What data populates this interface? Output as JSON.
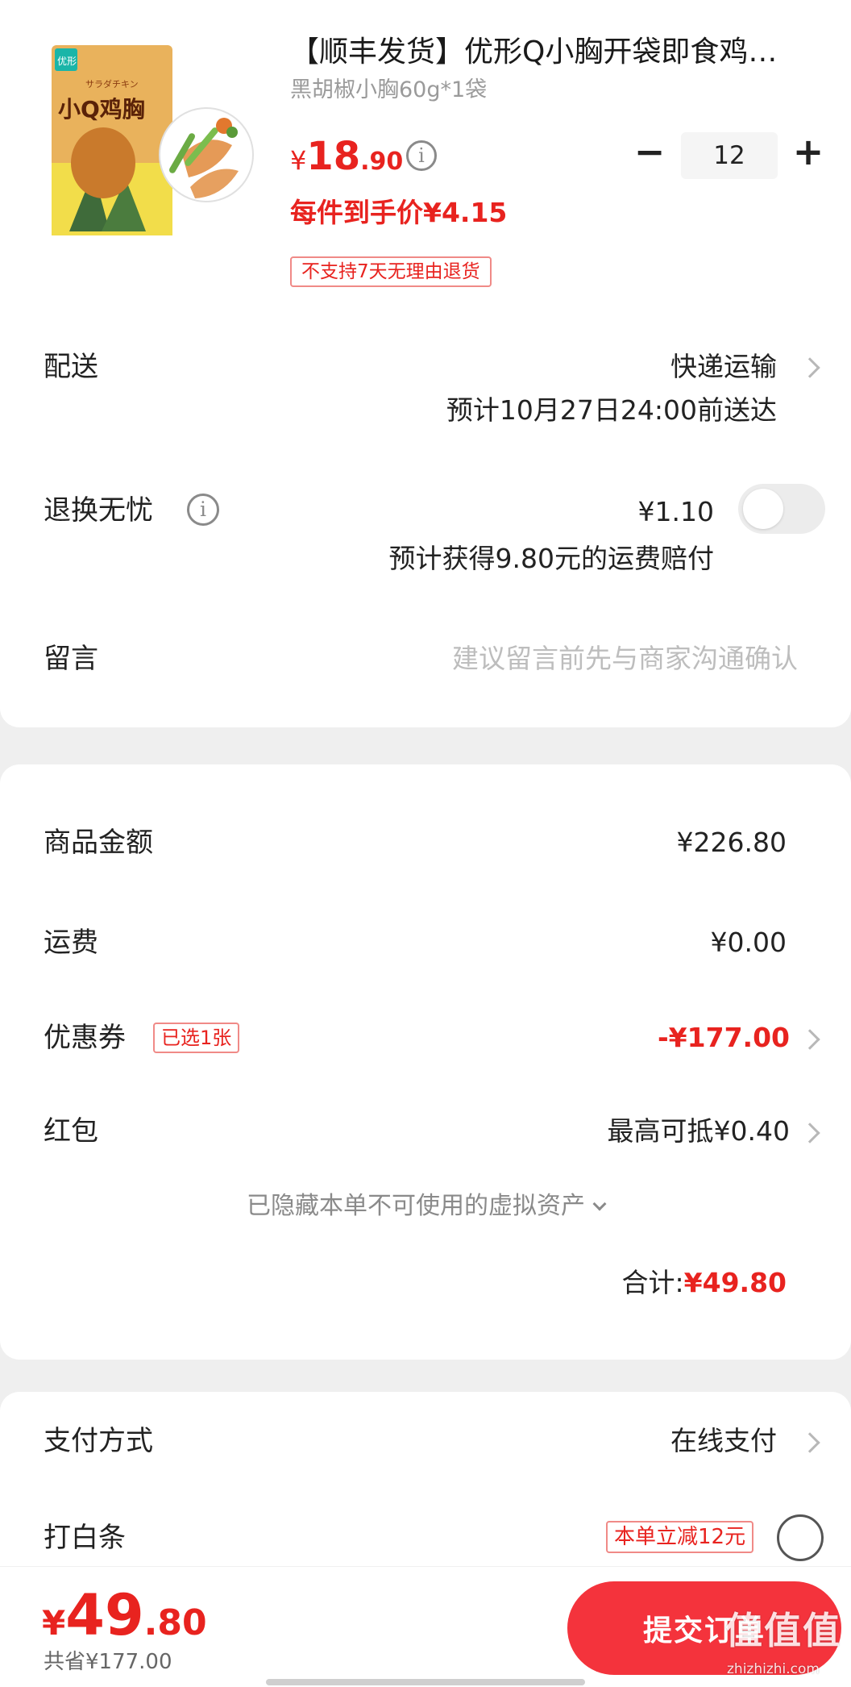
{
  "product": {
    "title": "【顺丰发货】优形Q小胸开袋即食鸡…",
    "spec": "黑胡椒小胸60g*1袋",
    "price_symbol": "¥",
    "price_int": "18",
    "price_dec": ".90",
    "info_glyph": "i",
    "unit_price": "每件到手价¥4.15",
    "no_return_badge": "不支持7天无理由退货",
    "quantity": "12",
    "qty_minus": "−",
    "qty_plus": "+",
    "package_brand": "优形",
    "package_name": "小Q鸡胸",
    "package_jp": "サラダチキン"
  },
  "delivery": {
    "label": "配送",
    "method": "快递运输",
    "eta": "预计10月27日24:00前送达"
  },
  "return_insurance": {
    "label": "退换无忧",
    "info_glyph": "i",
    "price": "¥1.10",
    "desc": "预计获得9.80元的运费赔付",
    "enabled": false
  },
  "message": {
    "label": "留言",
    "placeholder": "建议留言前先与商家沟通确认"
  },
  "summary": {
    "goods_label": "商品金额",
    "goods_value": "¥226.80",
    "shipping_label": "运费",
    "shipping_value": "¥0.00",
    "coupon_label": "优惠券",
    "coupon_badge": "已选1张",
    "coupon_value": "-¥177.00",
    "redpacket_label": "红包",
    "redpacket_value": "最高可抵¥0.40",
    "hidden_assets": "已隐藏本单不可使用的虚拟资产",
    "total_label": "合计:",
    "total_value": "¥49.80"
  },
  "payment": {
    "method_label": "支付方式",
    "method_value": "在线支付",
    "baitiao_label": "打白条",
    "baitiao_badge": "本单立减12元"
  },
  "bottom": {
    "price_symbol": "¥",
    "price_int": "49",
    "price_dec": ".80",
    "saved": "共省¥177.00",
    "submit": "提交订单"
  },
  "watermark": {
    "text": "值值值",
    "url": "zhizhizhi.com"
  },
  "colors": {
    "accent_red": "#e8231f",
    "button_red": "#f4333c"
  }
}
